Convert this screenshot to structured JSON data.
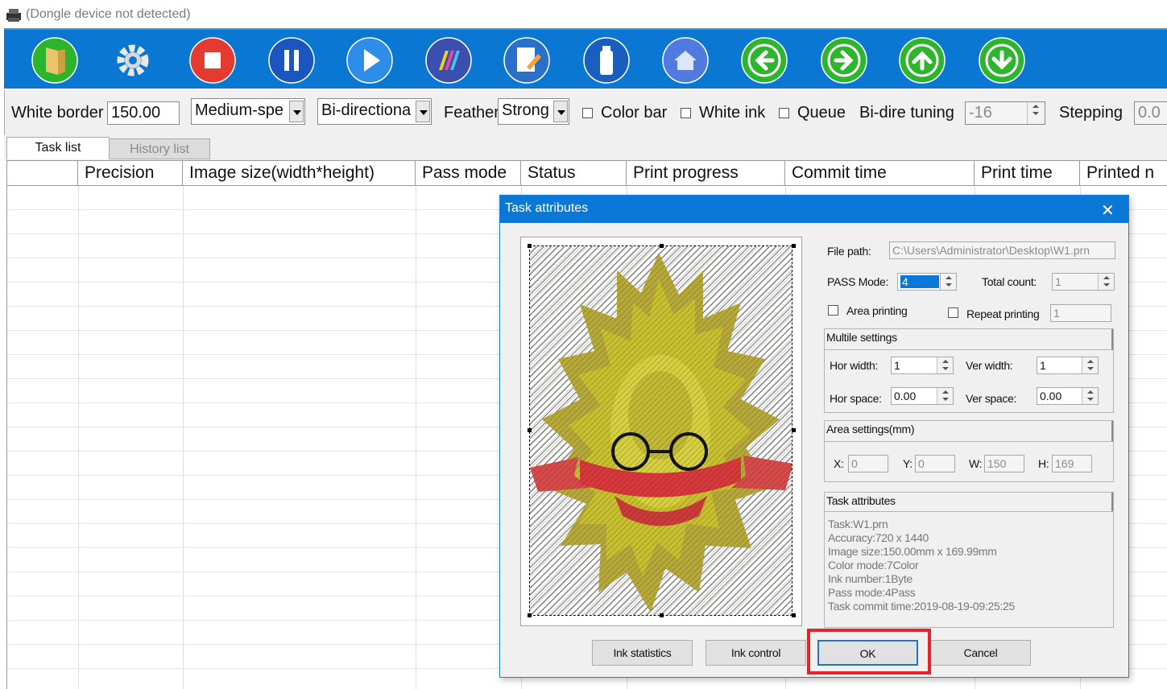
{
  "window": {
    "title": "(Dongle device not detected)"
  },
  "toolbar": {
    "buttons": [
      {
        "icon": "open-file-icon",
        "color": "#2db52d"
      },
      {
        "icon": "gear-icon",
        "color": "#1a6fc0"
      },
      {
        "icon": "stop-icon",
        "color": "#e53030"
      },
      {
        "icon": "pause-icon",
        "color": "#1a55c0"
      },
      {
        "icon": "play-icon",
        "color": "#2a8ae8"
      },
      {
        "icon": "color-palette-icon",
        "color": "#3b4fb0"
      },
      {
        "icon": "edit-document-icon",
        "color": "#2a70c8"
      },
      {
        "icon": "ink-bottle-icon",
        "color": "#1a5fc0"
      },
      {
        "icon": "home-icon",
        "color": "#4f7ae0"
      },
      {
        "icon": "arrow-left-icon",
        "color": "#2db52d"
      },
      {
        "icon": "arrow-right-icon",
        "color": "#2db52d"
      },
      {
        "icon": "arrow-up-icon",
        "color": "#2db52d"
      },
      {
        "icon": "arrow-down-icon",
        "color": "#2db52d"
      }
    ]
  },
  "options": {
    "white_border_label": "White border",
    "white_border_value": "150.00",
    "speed_value": "Medium-spe",
    "direction_value": "Bi-directiona",
    "feather_label": "Feather",
    "feather_value": "Strong",
    "color_bar_label": "Color bar",
    "white_ink_label": "White ink",
    "queue_label": "Queue",
    "bidir_tuning_label": "Bi-dire tuning",
    "bidir_tuning_value": "-16",
    "stepping_label": "Stepping",
    "stepping_value": "0.0"
  },
  "tabs": {
    "task_list": "Task list",
    "history_list": "History list"
  },
  "grid": {
    "columns": [
      "",
      "Precision",
      "Image size(width*height)",
      "Pass mode",
      "Status",
      "Print progress",
      "Commit time",
      "Print time",
      "Printed n"
    ]
  },
  "dialog": {
    "title": "Task attributes",
    "close": "✕",
    "file_path_label": "File path:",
    "file_path_value": "C:\\Users\\Administrator\\Desktop\\W1.prn",
    "pass_mode_label": "PASS Mode:",
    "pass_mode_value": "4",
    "total_count_label": "Total count:",
    "total_count_value": "1",
    "area_printing_label": "Area printing",
    "repeat_printing_label": "Repeat printing",
    "repeat_printing_value": "1",
    "multile": {
      "title": "Multile settings",
      "hor_width_label": "Hor width:",
      "hor_width_value": "1",
      "ver_width_label": "Ver width:",
      "ver_width_value": "1",
      "hor_space_label": "Hor space:",
      "hor_space_value": "0.00",
      "ver_space_label": "Ver space:",
      "ver_space_value": "0.00"
    },
    "area": {
      "title": "Area settings(mm)",
      "x_label": "X:",
      "x_value": "0",
      "y_label": "Y:",
      "y_value": "0",
      "w_label": "W:",
      "w_value": "150",
      "h_label": "H:",
      "h_value": "169"
    },
    "task_attributes": {
      "title": "Task attributes",
      "lines": [
        "Task:W1.prn",
        "Accuracy:720 x 1440",
        "Image size:150.00mm x 169.99mm",
        "Color mode:7Color",
        "Ink number:1Byte",
        "Pass mode:4Pass",
        "Task commit time:2019-08-19-09:25:25"
      ]
    },
    "buttons": {
      "ink_statistics": "Ink statistics",
      "ink_control": "Ink control",
      "ok": "OK",
      "cancel": "Cancel"
    }
  },
  "colors": {
    "toolbar_bg": "#0a78d2",
    "dialog_title_bg": "#0a78d7",
    "highlight": "#e3242b"
  }
}
